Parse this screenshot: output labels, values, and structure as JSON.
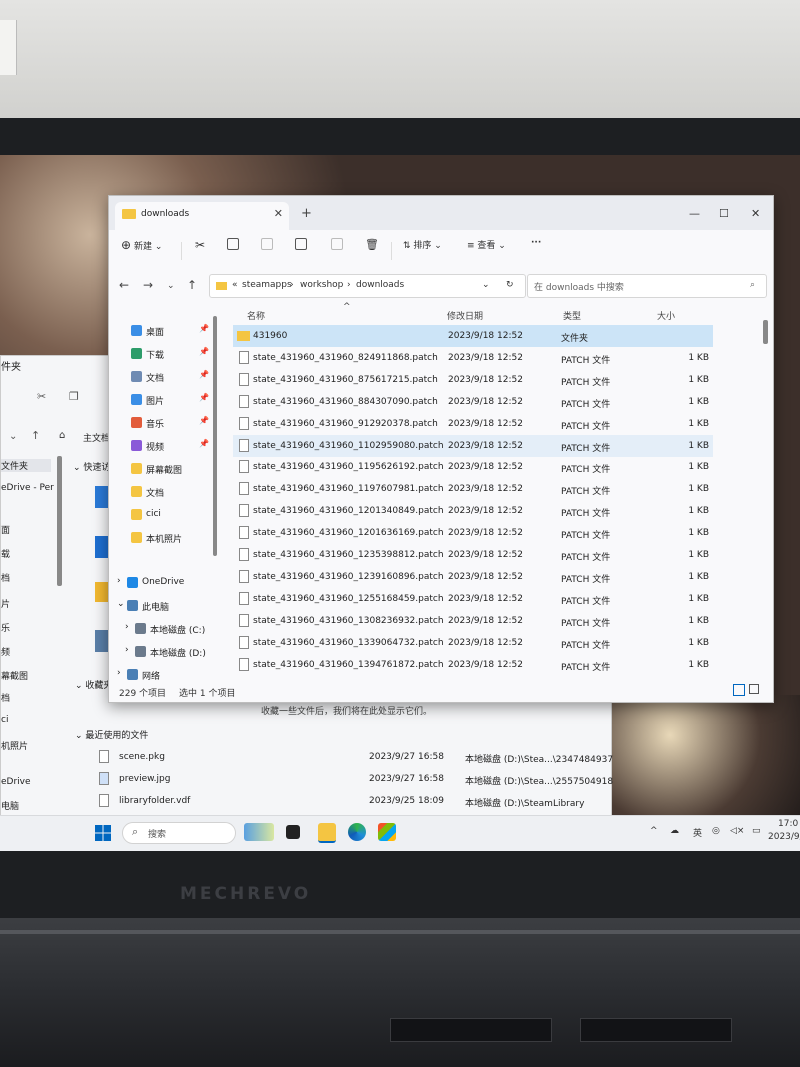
{
  "explorer": {
    "tab_title": "downloads",
    "toolbar": {
      "new_label": "新建",
      "sort_label": "排序",
      "view_label": "查看",
      "more_label": "···"
    },
    "breadcrumb": [
      "steamapps",
      "workshop",
      "downloads"
    ],
    "search_placeholder": "在 downloads 中搜索",
    "sidebar": [
      {
        "label": "桌面",
        "icon": "desktop-icon",
        "pinned": true
      },
      {
        "label": "下载",
        "icon": "download-icon",
        "pinned": true
      },
      {
        "label": "文档",
        "icon": "document-icon",
        "pinned": true
      },
      {
        "label": "图片",
        "icon": "picture-icon",
        "pinned": true
      },
      {
        "label": "音乐",
        "icon": "music-icon",
        "pinned": true
      },
      {
        "label": "视频",
        "icon": "video-icon",
        "pinned": true
      },
      {
        "label": "屏幕截图",
        "icon": "folder-icon",
        "pinned": false
      },
      {
        "label": "文档",
        "icon": "folder-icon",
        "pinned": false
      },
      {
        "label": "cici",
        "icon": "folder-icon",
        "pinned": false
      },
      {
        "label": "本机照片",
        "icon": "folder-icon",
        "pinned": false
      },
      {
        "label": "OneDrive",
        "icon": "cloud-icon",
        "pinned": false
      },
      {
        "label": "此电脑",
        "icon": "computer-icon",
        "pinned": false
      },
      {
        "label": "本地磁盘 (C:)",
        "icon": "drive-icon",
        "pinned": false
      },
      {
        "label": "本地磁盘 (D:)",
        "icon": "drive-icon",
        "pinned": false
      },
      {
        "label": "网络",
        "icon": "network-icon",
        "pinned": false
      }
    ],
    "columns": {
      "name": "名称",
      "date": "修改日期",
      "type": "类型",
      "size": "大小"
    },
    "files": [
      {
        "name": "431960",
        "date": "2023/9/18 12:52",
        "type": "文件夹",
        "size": "",
        "folder": true
      },
      {
        "name": "state_431960_431960_824911868.patch",
        "date": "2023/9/18 12:52",
        "type": "PATCH 文件",
        "size": "1 KB"
      },
      {
        "name": "state_431960_431960_875617215.patch",
        "date": "2023/9/18 12:52",
        "type": "PATCH 文件",
        "size": "1 KB"
      },
      {
        "name": "state_431960_431960_884307090.patch",
        "date": "2023/9/18 12:52",
        "type": "PATCH 文件",
        "size": "1 KB"
      },
      {
        "name": "state_431960_431960_912920378.patch",
        "date": "2023/9/18 12:52",
        "type": "PATCH 文件",
        "size": "1 KB"
      },
      {
        "name": "state_431960_431960_1102959080.patch",
        "date": "2023/9/18 12:52",
        "type": "PATCH 文件",
        "size": "1 KB"
      },
      {
        "name": "state_431960_431960_1195626192.patch",
        "date": "2023/9/18 12:52",
        "type": "PATCH 文件",
        "size": "1 KB"
      },
      {
        "name": "state_431960_431960_1197607981.patch",
        "date": "2023/9/18 12:52",
        "type": "PATCH 文件",
        "size": "1 KB"
      },
      {
        "name": "state_431960_431960_1201340849.patch",
        "date": "2023/9/18 12:52",
        "type": "PATCH 文件",
        "size": "1 KB"
      },
      {
        "name": "state_431960_431960_1201636169.patch",
        "date": "2023/9/18 12:52",
        "type": "PATCH 文件",
        "size": "1 KB"
      },
      {
        "name": "state_431960_431960_1235398812.patch",
        "date": "2023/9/18 12:52",
        "type": "PATCH 文件",
        "size": "1 KB"
      },
      {
        "name": "state_431960_431960_1239160896.patch",
        "date": "2023/9/18 12:52",
        "type": "PATCH 文件",
        "size": "1 KB"
      },
      {
        "name": "state_431960_431960_1255168459.patch",
        "date": "2023/9/18 12:52",
        "type": "PATCH 文件",
        "size": "1 KB"
      },
      {
        "name": "state_431960_431960_1308236932.patch",
        "date": "2023/9/18 12:52",
        "type": "PATCH 文件",
        "size": "1 KB"
      },
      {
        "name": "state_431960_431960_1339064732.patch",
        "date": "2023/9/18 12:52",
        "type": "PATCH 文件",
        "size": "1 KB"
      },
      {
        "name": "state_431960_431960_1394761872.patch",
        "date": "2023/9/18 12:52",
        "type": "PATCH 文件",
        "size": "1 KB"
      }
    ],
    "status_count": "229 个项目",
    "status_selected": "选中 1 个项目"
  },
  "back_window": {
    "title": "件夹",
    "address_crumb": "主文档",
    "quick_access": "快速访",
    "sidebar": [
      "文件夹",
      "eDrive - Per",
      "面",
      "载",
      "档",
      "片",
      "乐",
      "频",
      "幕截图",
      "档",
      "ci",
      "机照片",
      "eDrive",
      "电脑"
    ],
    "favorites_label": "收藏夹",
    "empty_favorites": "收藏一些文件后，我们将在此处显示它们。",
    "recent_label": "最近使用的文件",
    "recent": [
      {
        "name": "scene.pkg",
        "date": "2023/9/27 16:58",
        "location": "本地磁盘 (D:)\\Stea...\\2347484937"
      },
      {
        "name": "preview.jpg",
        "date": "2023/9/27 16:58",
        "location": "本地磁盘 (D:)\\Stea...\\2557504918"
      },
      {
        "name": "libraryfolder.vdf",
        "date": "2023/9/25 18:09",
        "location": "本地磁盘 (D:)\\SteamLibrary"
      }
    ]
  },
  "taskbar": {
    "search_label": "搜索",
    "ime": "英",
    "clock_time": "17:0",
    "clock_date": "2023/9/2"
  },
  "hardware": {
    "brand": "MECHREVO"
  },
  "colors": {
    "selection": "#cce4f7",
    "folder": "#f4c542",
    "accent": "#0067c0"
  }
}
